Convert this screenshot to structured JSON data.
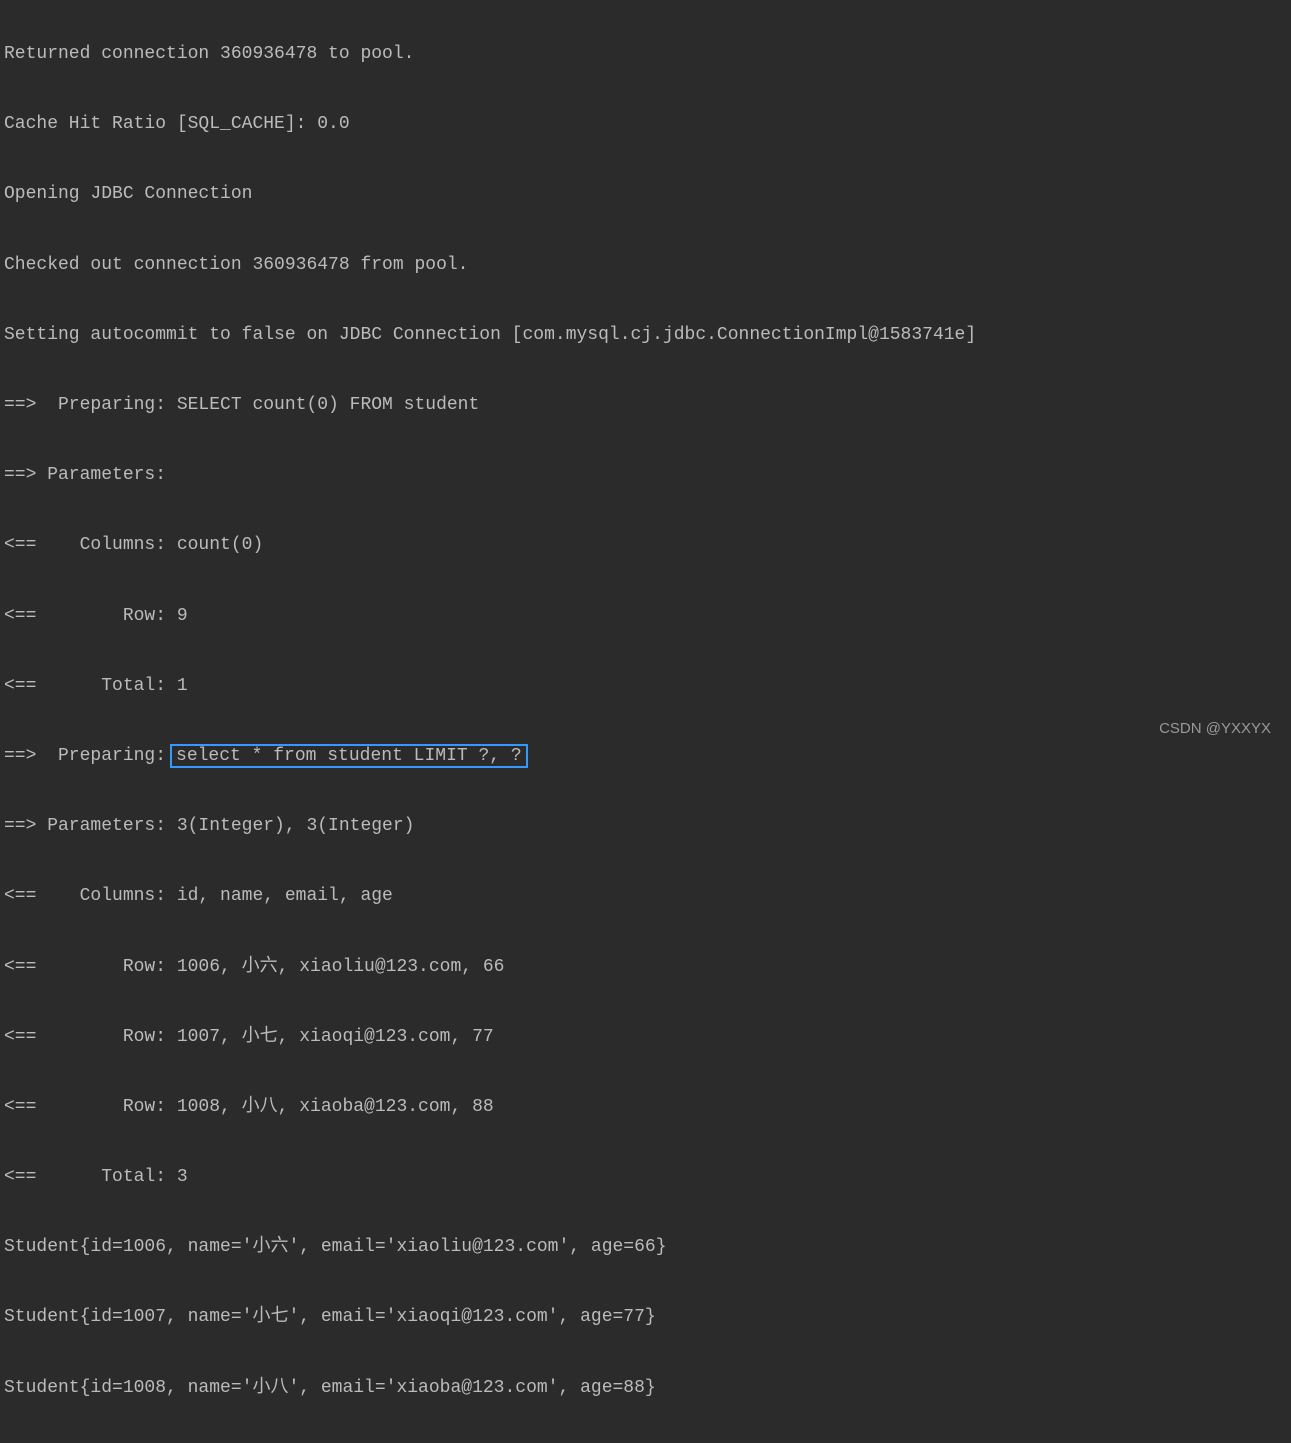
{
  "lines": {
    "l1": "Returned connection 360936478 to pool.",
    "l2": "Cache Hit Ratio [SQL_CACHE]: 0.0",
    "l3": "Opening JDBC Connection",
    "l4": "Checked out connection 360936478 from pool.",
    "l5": "Setting autocommit to false on JDBC Connection [com.mysql.cj.jdbc.ConnectionImpl@1583741e]",
    "l6": "==>  Preparing: SELECT count(0) FROM student",
    "l7": "==> Parameters:",
    "l8": "<==    Columns: count(0)",
    "l9": "<==        Row: 9",
    "l10": "<==      Total: 1",
    "l11_prefix": "==>  Preparing:",
    "l11_sql": "select * from student LIMIT ?, ?",
    "l12": "==> Parameters: 3(Integer), 3(Integer)",
    "l13": "<==    Columns: id, name, email, age",
    "l14": "<==        Row: 1006, 小六, xiaoliu@123.com, 66",
    "l15": "<==        Row: 1007, 小七, xiaoqi@123.com, 77",
    "l16": "<==        Row: 1008, 小八, xiaoba@123.com, 88",
    "l17": "<==      Total: 3",
    "l18": "Student{id=1006, name='小六', email='xiaoliu@123.com', age=66}",
    "l19": "Student{id=1007, name='小七', email='xiaoqi@123.com', age=77}",
    "l20": "Student{id=1008, name='小八', email='xiaoba@123.com', age=88}"
  },
  "watermark": "CSDN @YXXYX"
}
